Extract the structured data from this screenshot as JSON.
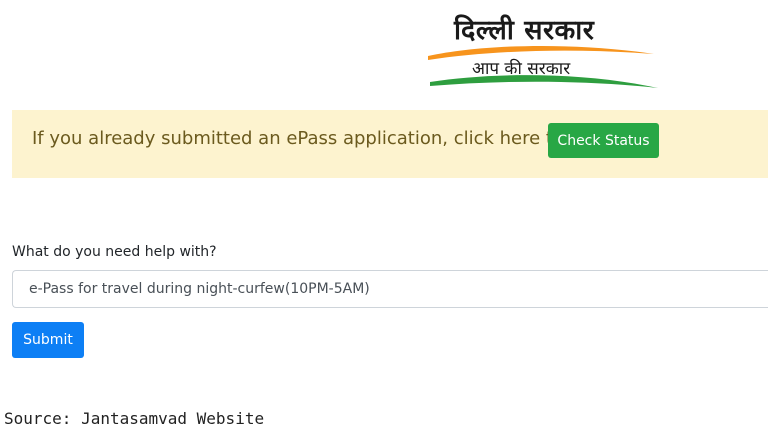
{
  "logo": {
    "title": "दिल्ली सरकार",
    "tagline": "आप की सरकार",
    "colors": {
      "saffron": "#f7941d",
      "green": "#2e9e3f"
    }
  },
  "alert": {
    "message": "If you already submitted an ePass application, click here to",
    "button_label": "Check Status",
    "background": "#fdf3cf",
    "button_color": "#28a745"
  },
  "form": {
    "question": "What do you need help with?",
    "selected_option": "e-Pass for travel during night-curfew(10PM-5AM)",
    "submit_label": "Submit",
    "submit_color": "#0d7ff5"
  },
  "caption": "Source: Jantasamvad Website"
}
